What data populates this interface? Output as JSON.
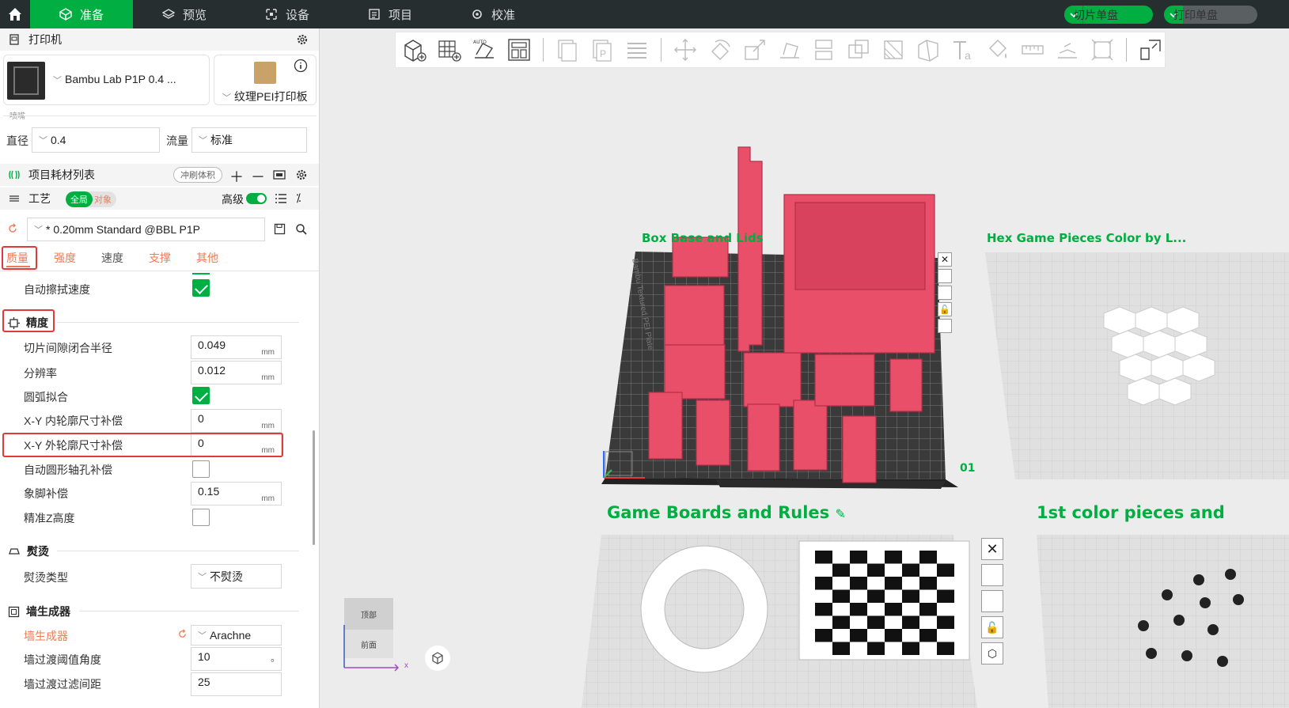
{
  "topbar": {
    "tabs": [
      {
        "label": "准备",
        "active": true
      },
      {
        "label": "预览"
      },
      {
        "label": "设备"
      },
      {
        "label": "项目"
      },
      {
        "label": "校准"
      }
    ],
    "slice_label": "切片单盘",
    "print_label": "打印单盘"
  },
  "printer": {
    "section_title": "打印机",
    "printer_name": "Bambu Lab P1P 0.4 ...",
    "plate_name": "纹理PEI打印板",
    "nozzle_label": "喷嘴",
    "diameter_label": "直径",
    "diameter_value": "0.4",
    "flow_label": "流量",
    "flow_value": "标准"
  },
  "filament": {
    "section_title": "项目耗材列表",
    "flush_label": "冲刷体积"
  },
  "process": {
    "section_title": "工艺",
    "toggle_global": "全局",
    "toggle_object": "对象",
    "advanced_label": "高级",
    "profile_name": "* 0.20mm Standard @BBL P1P",
    "tabs": [
      "质量",
      "强度",
      "速度",
      "支撑",
      "其他"
    ]
  },
  "settings": {
    "auto_wipe_speed": "自动擦拭速度",
    "precision_title": "精度",
    "slice_gap_closing_radius": {
      "label": "切片间隙闭合半径",
      "value": "0.049",
      "unit": "mm"
    },
    "resolution": {
      "label": "分辨率",
      "value": "0.012",
      "unit": "mm"
    },
    "arc_fitting": "圆弧拟合",
    "xy_hole_comp": {
      "label": "X-Y 内轮廓尺寸补偿",
      "value": "0",
      "unit": "mm"
    },
    "xy_contour_comp": {
      "label": "X-Y 外轮廓尺寸补偿",
      "value": "0",
      "unit": "mm"
    },
    "auto_circle_hole": "自动圆形轴孔补偿",
    "elephant_foot": {
      "label": "象脚补偿",
      "value": "0.15",
      "unit": "mm"
    },
    "precise_z": "精准Z高度",
    "ironing_title": "熨烫",
    "ironing_type": {
      "label": "熨烫类型",
      "value": "不熨烫"
    },
    "wall_gen_title": "墙生成器",
    "wall_generator": {
      "label": "墙生成器",
      "value": "Arachne"
    },
    "wall_transition_angle": {
      "label": "墙过渡阈值角度",
      "value": "10",
      "unit": "°"
    },
    "wall_transition_filter": {
      "label": "墙过渡过滤间距",
      "value": "25"
    }
  },
  "viewport": {
    "plate1_title": "Box Base and Lids",
    "plate2_title": "Hex Game Pieces Color by L...",
    "plate3_title": "Game Boards and Rules",
    "plate4_title": "1st color pieces and",
    "plate_number": "01",
    "bed_label": "Bambu Textured PEI Plate",
    "view_top": "顶部",
    "view_front": "前面",
    "axis_x": "x"
  },
  "colors": {
    "accent": "#00ae42",
    "model": "#ea4f6a",
    "highlight": "#e03a3a"
  }
}
